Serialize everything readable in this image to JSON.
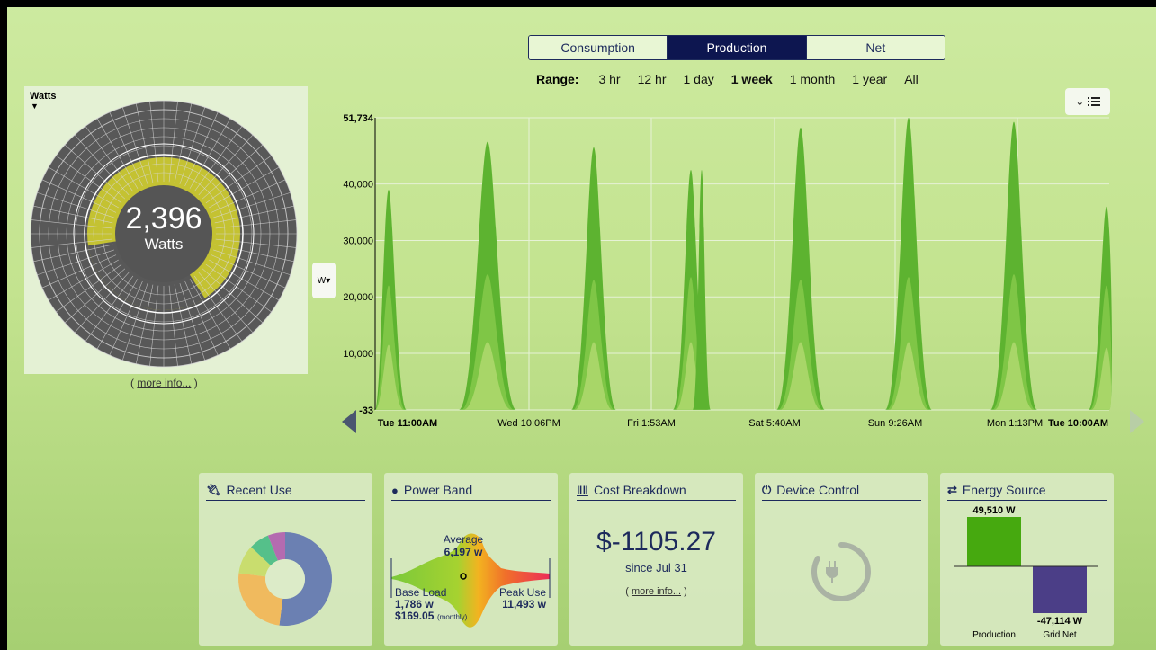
{
  "tabs": [
    {
      "label": "Consumption",
      "active": false
    },
    {
      "label": "Production",
      "active": true
    },
    {
      "label": "Net",
      "active": false
    }
  ],
  "range": {
    "label": "Range:",
    "options": [
      "3 hr",
      "12 hr",
      "1 day",
      "1 week",
      "1 month",
      "1 year",
      "All"
    ],
    "selected": "1 week"
  },
  "gauge": {
    "title": "Watts",
    "value": "2,396",
    "unit": "Watts",
    "more_info": "more info...",
    "fill_fraction": 0.43
  },
  "unit_toggle": "W",
  "chart_data": {
    "type": "area",
    "ylim": [
      -33,
      51734
    ],
    "y_ticks": [
      "51,734",
      "40,000",
      "30,000",
      "20,000",
      "10,000",
      "-33"
    ],
    "x_ticks": [
      "Tue 11:00AM",
      "Wed 10:06PM",
      "Fri 1:53AM",
      "Sat 5:40AM",
      "Sun 9:26AM",
      "Mon 1:13PM",
      "Tue 10:00AM"
    ],
    "series": [
      {
        "color": "#5db330",
        "peaks": [
          39000,
          47500,
          46500,
          42500,
          50000,
          51734,
          51000,
          36000
        ]
      },
      {
        "color": "#7fc646",
        "peaks": [
          22000,
          24000,
          23000,
          23500,
          23000,
          23500,
          24000,
          22000
        ]
      },
      {
        "color": "#a8d668",
        "peaks": [
          11500,
          12000,
          12000,
          12000,
          12000,
          12000,
          12000,
          11000
        ]
      }
    ]
  },
  "cards": {
    "recent_use": {
      "title": "Recent Use"
    },
    "power_band": {
      "title": "Power Band",
      "average_label": "Average",
      "average_value": "6,197 w",
      "base_label": "Base Load",
      "base_value": "1,786 w",
      "base_cost": "$169.05",
      "base_cost_note": "(monthly)",
      "peak_label": "Peak Use",
      "peak_value": "11,493 w"
    },
    "cost_breakdown": {
      "title": "Cost Breakdown",
      "amount": "$-1105.27",
      "since": "since Jul 31",
      "more_info": "more info..."
    },
    "device_control": {
      "title": "Device Control"
    },
    "energy_source": {
      "title": "Energy Source",
      "production_value": "49,510 W",
      "production_label": "Production",
      "grid_value": "-47,114 W",
      "grid_label": "Grid Net",
      "production_color": "#46a90f",
      "grid_color": "#4b3e87"
    }
  },
  "donut": [
    {
      "fraction": 0.52,
      "color": "#6b80b2"
    },
    {
      "fraction": 0.25,
      "color": "#f0ba5e"
    },
    {
      "fraction": 0.1,
      "color": "#c9dd6e"
    },
    {
      "fraction": 0.07,
      "color": "#55c08a"
    },
    {
      "fraction": 0.06,
      "color": "#b46bb0"
    }
  ]
}
